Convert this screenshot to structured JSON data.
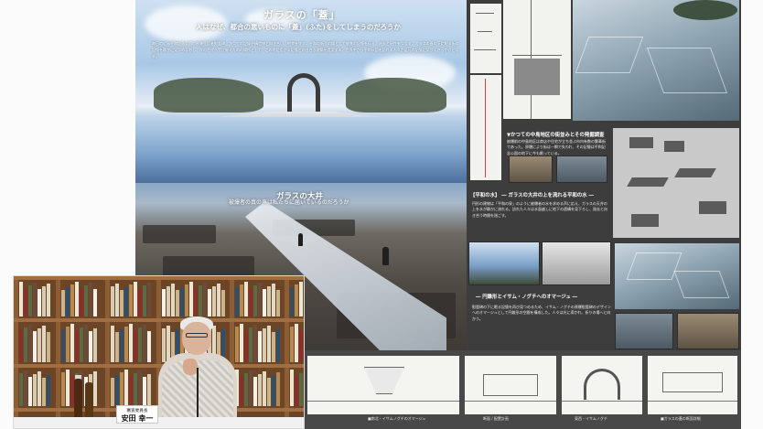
{
  "hero": {
    "title": "ガラスの「蓋」",
    "subtitle": "人はなぜ、都合の悪いものに「蓋」(ふた)をしてしまうのだろうか",
    "body": "毎日の広島平和記念公園の原爆死没者慰霊碑、かつての記録や構造物と向き合い、約束を守る。平和の祈りの場として被爆の記憶を伝え、過去と現在をつなぐ。ガラスの蓋の下に眠る街の記憶を静かに見つめなおし、次の世代へ受け継ぐための場所として、この地に広がる記憶と向き合う建築を提案する。世界中から平和公園を訪れる人々が足元の記憶に気づくきっかけとなる。"
  },
  "band": {
    "title": "ガラスの大井",
    "subtitle": "被爆者の真の声は私たちに届いているのだろうか"
  },
  "poster": {
    "heading1": "▼かつての中島地区の街並みとその発掘調査",
    "text1": "被爆前の中島地区は商店や住宅が立ち並ぶ市内有数の繁華街であった。原爆により街は一瞬で失われ、その記憶は平和記念公園の地下に今も眠っている。",
    "heading2": "【平和の水】 ― ガラスの大井の上を流れる平和の水 ―",
    "text2": "円形の建物は「平和の泉」のように被爆者の水を求める声に応え、ガラスの天井の上を水が静かに流れる。訪れた人々は水面越しに地下の遺構を見下ろし、過去と向き合う時間を過ごす。",
    "heading3": "― 円錐形とイサム・ノグチへのオマージュ ―",
    "text3": "慰霊碑の下に眠る記憶を再び見つめるため、イサム・ノグチの原爆慰霊碑のデザインへのオマージュとして円錐形の空間を構成した。人々は光に導かれ、祈りの場へと向かう。"
  },
  "strip": {
    "captions": [
      "■南北・イサムノグチのオマージュ",
      "断面 / 配置計画",
      "東西・イサムノグチ",
      "■ガラスの蓋の断面詳細"
    ]
  },
  "video": {
    "role": "審査委員長",
    "name": "安田 幸一"
  },
  "colors": {
    "poster_bg": "#3d3d3d",
    "sheet_bg": "#f2f2ef",
    "shelf_wood": "#8d5d33"
  }
}
